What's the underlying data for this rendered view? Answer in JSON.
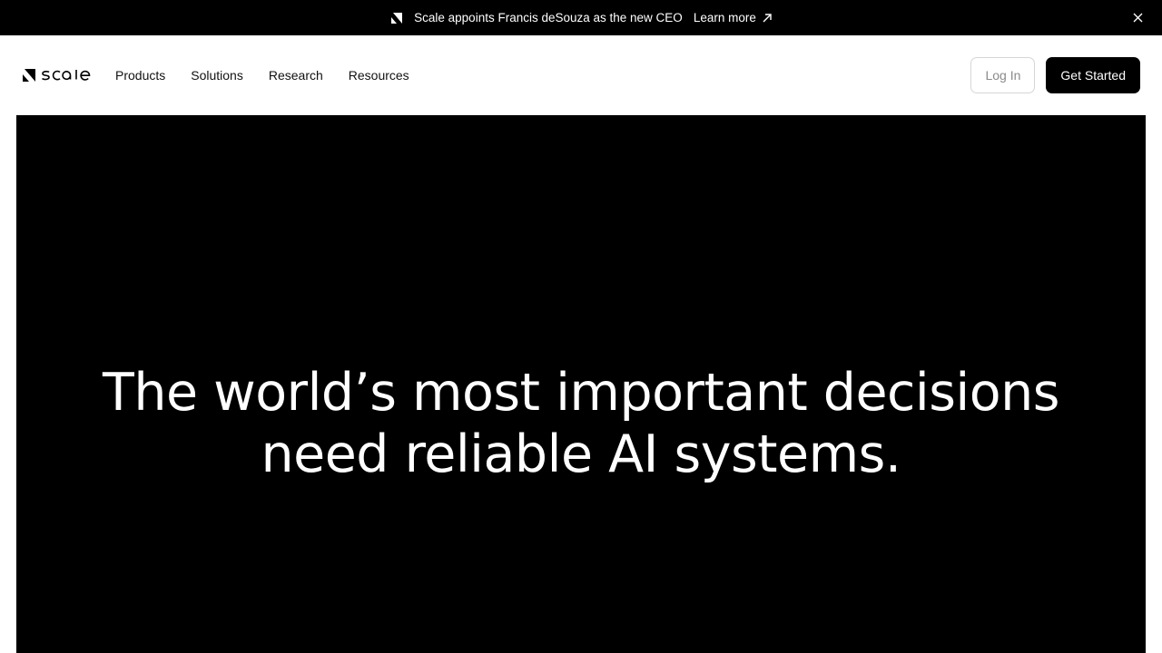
{
  "announcement": {
    "text": "Scale appoints Francis deSouza as the new CEO",
    "link_label": "Learn more",
    "logo_icon": "scale-mark-icon",
    "arrow_icon": "arrow-up-right-icon",
    "close_icon": "close-icon"
  },
  "nav": {
    "brand_icon": "scale-logo",
    "items": [
      {
        "label": "Products"
      },
      {
        "label": "Solutions"
      },
      {
        "label": "Research"
      },
      {
        "label": "Resources"
      }
    ],
    "login_label": "Log In",
    "cta_label": "Get Started"
  },
  "hero": {
    "line1": "The world’s most important decisions",
    "line2": "need reliable AI systems."
  },
  "colors": {
    "background": "#ffffff",
    "dark": "#000000",
    "text_light": "#ffffff",
    "muted": "#8a8a8a"
  }
}
